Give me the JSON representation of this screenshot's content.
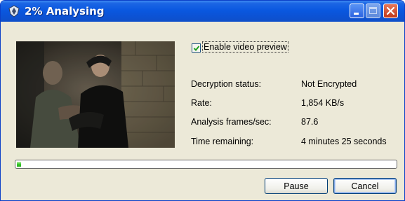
{
  "window": {
    "title": "2% Analysing",
    "title_icon": "shield-logo-icon",
    "controls": [
      "minimize-icon",
      "maximize-icon",
      "close-icon"
    ]
  },
  "preview": {
    "checkbox_label": "Enable video preview",
    "checked": true
  },
  "stats": [
    {
      "label": "Decryption status:",
      "value": "Not Encrypted"
    },
    {
      "label": "Rate:",
      "value": "1,854 KB/s"
    },
    {
      "label": "Analysis frames/sec:",
      "value": "87.6"
    },
    {
      "label": "Time remaining:",
      "value": "4 minutes 25 seconds"
    }
  ],
  "progress": {
    "percent": 2,
    "fill_color": "#37c82a"
  },
  "buttons": {
    "pause": "Pause",
    "cancel": "Cancel"
  },
  "colors": {
    "titlebar": "#0a58e0",
    "window_bg": "#ece9d8",
    "close_button": "#c2391b"
  }
}
